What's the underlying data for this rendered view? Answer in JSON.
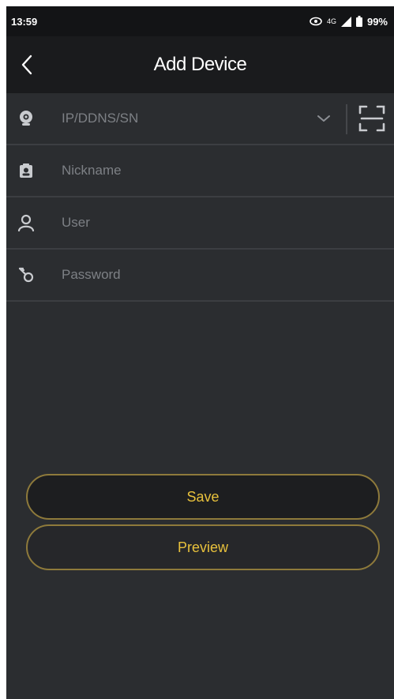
{
  "status_bar": {
    "time": "13:59",
    "network": "4G",
    "battery": "99%"
  },
  "header": {
    "title": "Add Device"
  },
  "form": {
    "address": {
      "placeholder": "IP/DDNS/SN",
      "value": ""
    },
    "nickname": {
      "placeholder": "Nickname",
      "value": ""
    },
    "user": {
      "placeholder": "User",
      "value": ""
    },
    "password": {
      "placeholder": "Password",
      "value": ""
    }
  },
  "actions": {
    "save_label": "Save",
    "preview_label": "Preview"
  },
  "colors": {
    "accent": "#e8c13c",
    "button_border": "#8e7a3b",
    "background": "#2b2d30",
    "header_bg": "#1a1b1d"
  }
}
